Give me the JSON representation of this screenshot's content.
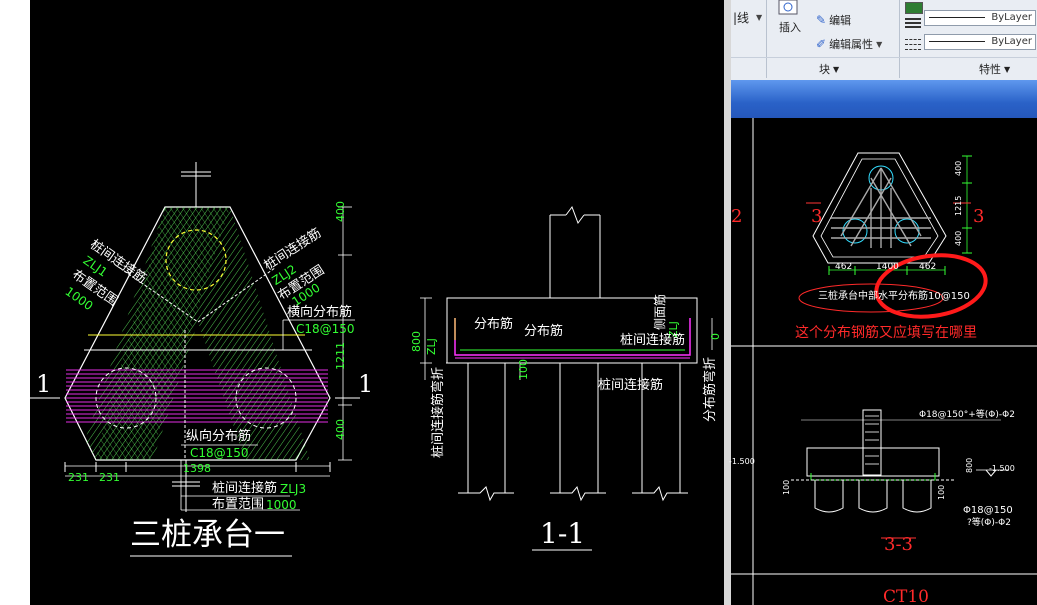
{
  "left_drawing": {
    "plan_title": "三桩承台一",
    "section_title": "1-1",
    "section_mark_left": "1",
    "section_mark_right": "1",
    "zlj1_label": "桩间连接筋",
    "zlj1_code": "ZLJ1",
    "zlj1_range": "布置范围",
    "zlj1_range_val": "1000",
    "zlj2_label": "桩间连接筋",
    "zlj2_code": "ZLJ2",
    "zlj2_range": "布置范围",
    "zlj2_range_val": "1000",
    "transverse_label": "横向分布筋",
    "transverse_spec": "C18@150",
    "longitudinal_label": "纵向分布筋",
    "longitudinal_spec": "C18@150",
    "zlj3_label": "桩间连接筋",
    "zlj3_code": "ZLJ3",
    "zlj3_range": "布置范围",
    "zlj3_range_val": "1000",
    "dim_400_top": "400",
    "dim_1211": "1211",
    "dim_400_bottom": "400",
    "dim_231_a": "231",
    "dim_231_b": "231",
    "dim_1398": "1398",
    "sec_dim_800": "800",
    "sec_dim_100": "100",
    "sec_dim_0": "0",
    "sec_zlj": "ZLJ",
    "sec_dist1": "分布筋",
    "sec_dist2": "分布筋",
    "sec_top_face": "侧面筋",
    "sec_zlj_right": "ZLJ",
    "sec_conn1": "桩间连接筋",
    "sec_conn2": "桩间连接筋",
    "sec_left_vertical": "桩间连接筋弯折",
    "sec_right_vertical": "分布筋弯折"
  },
  "ribbon": {
    "partial_label": "|线",
    "insert_label": "插入",
    "edit_label": "编辑",
    "edit_attr_label": "编辑属性",
    "block_group": "块",
    "props_group": "特性",
    "bylayer_1": "ByLayer",
    "bylayer_2": "ByLayer"
  },
  "right_drawing": {
    "mark_2": "2",
    "mark_3_left": "3",
    "mark_3_right": "3",
    "dim_400_a": "400",
    "dim_1215": "1215",
    "dim_400_b": "400",
    "dim_462_a": "462",
    "dim_1400": "1400",
    "dim_462_b": "462",
    "note_text": "三桩承台中部水平分布筋10@150",
    "question": "这个分布钢筋又应填写在哪里",
    "sec_label": "3-3",
    "tag_bottom": "CT10",
    "elev_left": "-1.500",
    "elev_right": "-1.500",
    "rebar_note_1": "Φ18@150°+等(Φ)-Φ2",
    "rebar_note_2": "Φ18@150",
    "rebar_note_3": "?等(Φ)-Φ2",
    "dim_800": "800",
    "dim_100_a": "100",
    "dim_100_b": "100"
  }
}
